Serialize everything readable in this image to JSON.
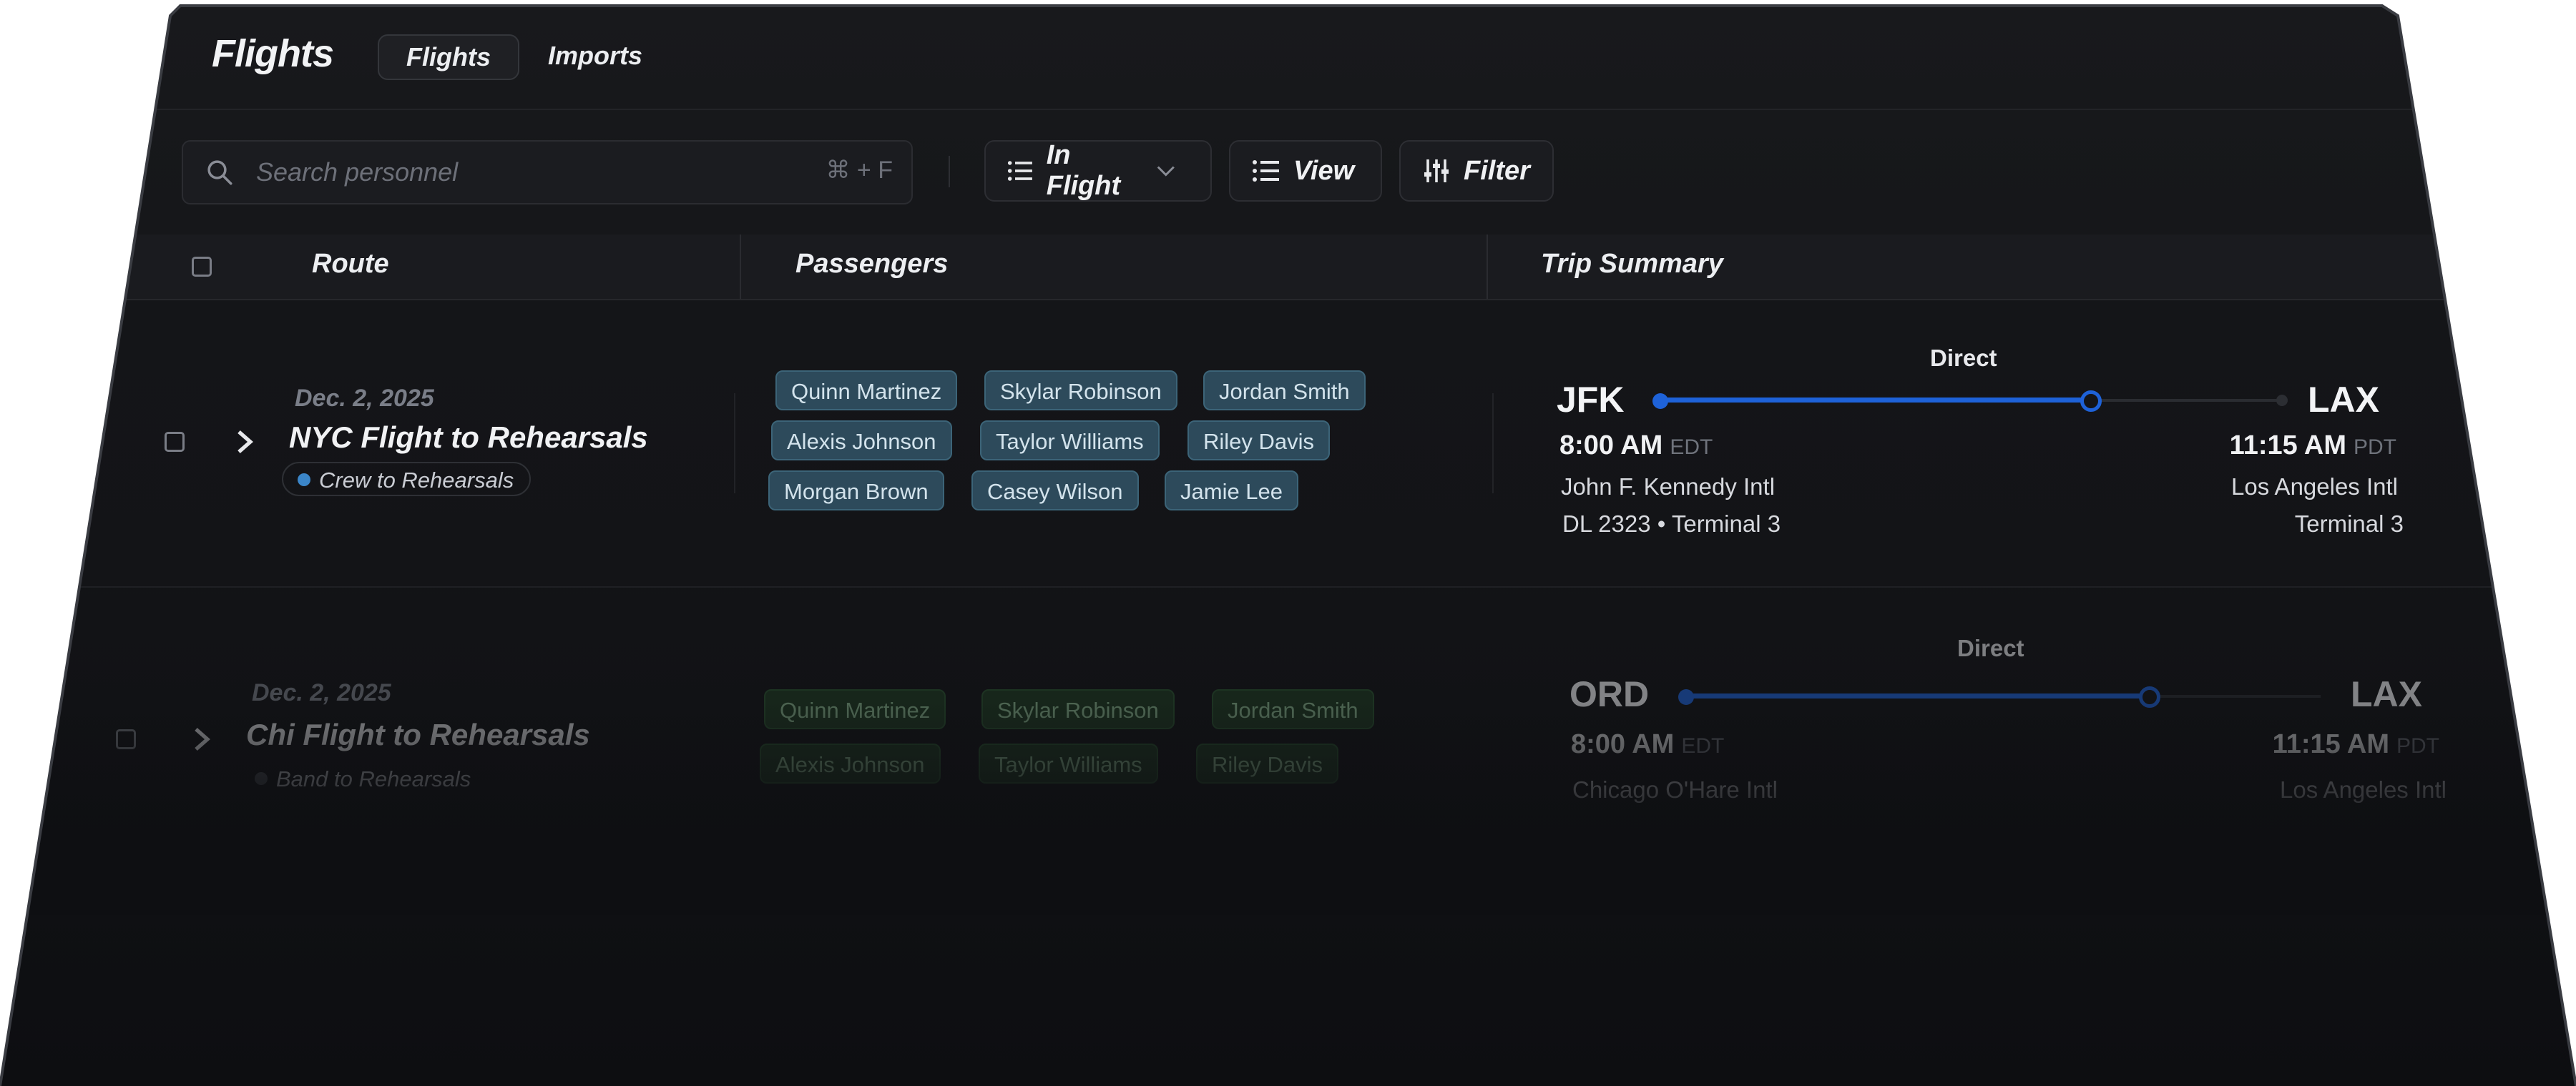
{
  "app": {
    "title": "Flights",
    "tabs": [
      {
        "label": "Flights",
        "active": true
      },
      {
        "label": "Imports",
        "active": false
      }
    ]
  },
  "toolbar": {
    "search_placeholder": "Search personnel",
    "search_value": "",
    "search_shortcut": "⌘ + F",
    "status_filter_label": "In Flight",
    "view_label": "View",
    "filter_label": "Filter"
  },
  "table": {
    "columns": [
      "Route",
      "Passengers",
      "Trip Summary"
    ],
    "rows": [
      {
        "date": "Dec. 2, 2025",
        "name": "NYC Flight to Rehearsals",
        "tag": "Crew to Rehearsals",
        "tag_color": "#3b86c9",
        "chip_color": "blue",
        "passengers": [
          "Quinn Martinez",
          "Skylar Robinson",
          "Jordan Smith",
          "Alexis Johnson",
          "Taylor Williams",
          "Riley Davis",
          "Morgan Brown",
          "Casey Wilson",
          "Jamie Lee"
        ],
        "trip": {
          "type": "Direct",
          "origin": {
            "code": "JFK",
            "time": "8:00 AM",
            "tz": "EDT",
            "airport": "John F. Kennedy Intl",
            "detail": "DL 2323 • Terminal 3"
          },
          "destination": {
            "code": "LAX",
            "time": "11:15 AM",
            "tz": "PDT",
            "airport": "Los Angeles Intl",
            "detail": "Terminal 3"
          },
          "progress": 0.72
        }
      },
      {
        "date": "Dec. 2, 2025",
        "name": "Chi Flight to Rehearsals",
        "tag": "Band to Rehearsals",
        "tag_color": "#4a4d55",
        "chip_color": "green",
        "passengers": [
          "Quinn Martinez",
          "Skylar Robinson",
          "Jordan Smith",
          "Alexis Johnson",
          "Taylor Williams",
          "Riley Davis"
        ],
        "trip": {
          "type": "Direct",
          "origin": {
            "code": "ORD",
            "time": "8:00 AM",
            "tz": "EDT",
            "airport": "Chicago O'Hare Intl"
          },
          "destination": {
            "code": "LAX",
            "time": "11:15 AM",
            "tz": "PDT",
            "airport": "Los Angeles Intl"
          },
          "progress": 0.72
        }
      }
    ]
  },
  "colors": {
    "accent": "#1e62d8",
    "background": "#141518",
    "chip_blue": "#2d4a5b",
    "chip_green": "#1e3a22"
  }
}
